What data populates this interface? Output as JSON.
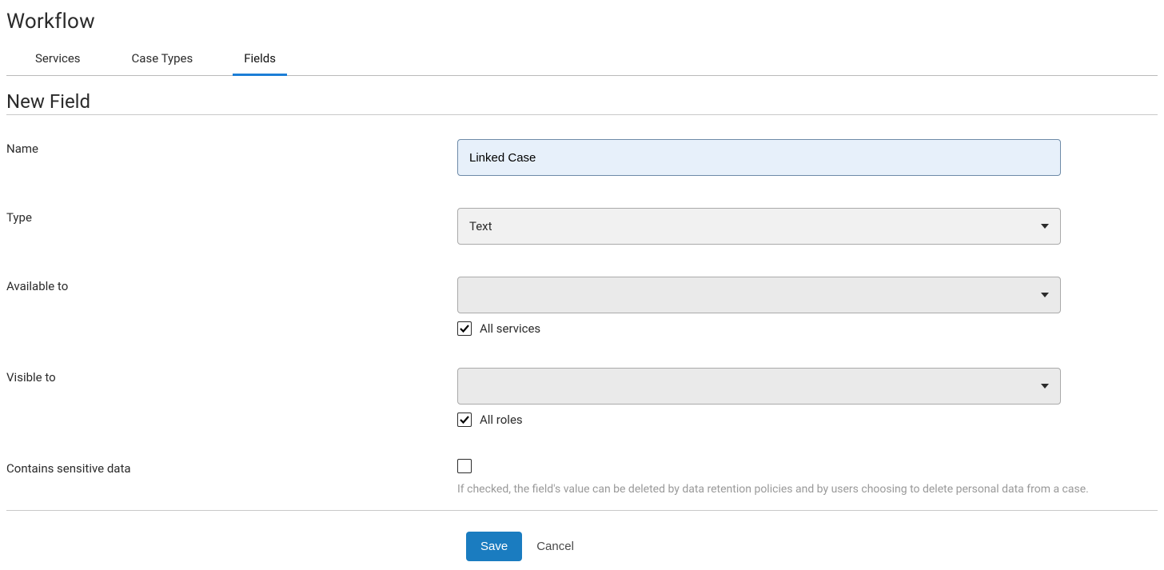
{
  "header": {
    "title": "Workflow"
  },
  "tabs": [
    {
      "label": "Services",
      "active": false
    },
    {
      "label": "Case Types",
      "active": false
    },
    {
      "label": "Fields",
      "active": true
    }
  ],
  "section": {
    "title": "New Field"
  },
  "form": {
    "name": {
      "label": "Name",
      "value": "Linked Case"
    },
    "type": {
      "label": "Type",
      "value": "Text"
    },
    "available_to": {
      "label": "Available to",
      "select_value": "",
      "all_services_label": "All services",
      "all_services_checked": true
    },
    "visible_to": {
      "label": "Visible to",
      "select_value": "",
      "all_roles_label": "All roles",
      "all_roles_checked": true
    },
    "sensitive": {
      "label": "Contains sensitive data",
      "checked": false,
      "help": "If checked, the field's value can be deleted by data retention policies and by users choosing to delete personal data from a case."
    }
  },
  "actions": {
    "save": "Save",
    "cancel": "Cancel"
  }
}
